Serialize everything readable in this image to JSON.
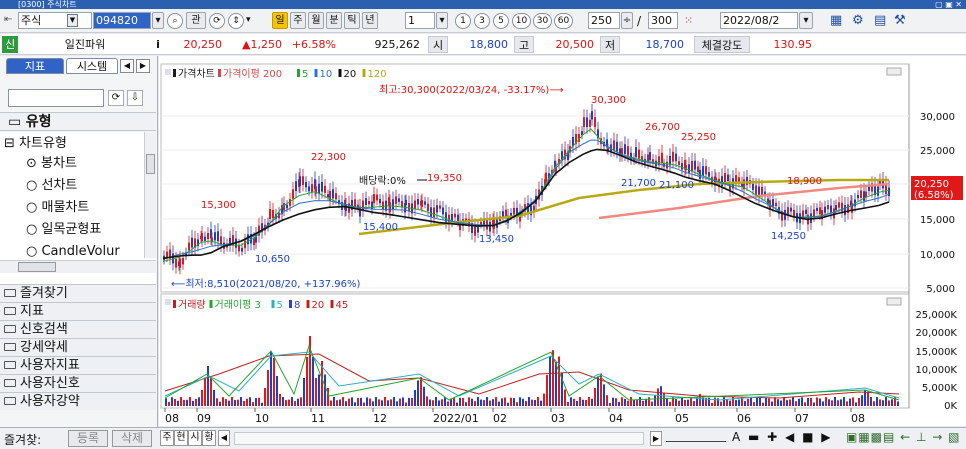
{
  "window": {
    "title": "[0300] 주식차트"
  },
  "toolbar": {
    "market": "주식",
    "code": "094820",
    "btn_gwan": "관",
    "period_buttons": [
      "일",
      "주",
      "월",
      "분",
      "틱",
      "년"
    ],
    "interval_value": "1",
    "interval_buttons": [
      "1",
      "3",
      "5",
      "10",
      "30",
      "60"
    ],
    "count_value": "250",
    "count_total": "300",
    "date_value": "2022/08/2"
  },
  "info": {
    "badge": "신",
    "name": "일진파워",
    "flag": "i",
    "price": "20,250",
    "change": "▲1,250",
    "rate": "+6.58%",
    "volume": "925,262",
    "open_label": "시",
    "open": "18,800",
    "high_label": "고",
    "high": "20,500",
    "low_label": "저",
    "low": "18,700",
    "strength_label": "체결강도",
    "strength": "130.95"
  },
  "left_panel": {
    "tabs": [
      "지표",
      "시스템"
    ],
    "section_title": "유형",
    "tree_title": "차트유형",
    "chart_types": [
      "봉차트",
      "선차트",
      "매물차트",
      "일목균형표",
      "CandleVolur"
    ],
    "categories": [
      "즐겨찾기",
      "지표",
      "신호검색",
      "강세약세",
      "사용자지표",
      "사용자신호",
      "사용자강약"
    ],
    "footer_label": "즐겨찾:",
    "footer_add": "등록",
    "footer_del": "삭제"
  },
  "chart": {
    "price_legend": [
      {
        "text": "가격차트",
        "color": "#1a1a1a"
      },
      {
        "text": "가격이평 200",
        "color": "#d34a4a"
      },
      {
        "text": "5",
        "color": "#23a52f"
      },
      {
        "text": "10",
        "color": "#2e6fcf"
      },
      {
        "text": "20",
        "color": "#111111"
      },
      {
        "text": "120",
        "color": "#b7a915"
      }
    ],
    "volume_legend": [
      {
        "text": "거래량",
        "color": "#c22020"
      },
      {
        "text": "거래이평 3",
        "color": "#23a52f"
      },
      {
        "text": "5",
        "color": "#2ab0c8"
      },
      {
        "text": "8",
        "color": "#2e3fcf"
      },
      {
        "text": "20",
        "color": "#c22020"
      },
      {
        "text": "45",
        "color": "#c22020"
      }
    ],
    "price_axis": [
      "30,000",
      "25,000",
      "20,000",
      "15,000",
      "10,000",
      "5,000"
    ],
    "volume_axis": [
      "25,000K",
      "20,000K",
      "15,000K",
      "10,000K",
      "5,000K",
      "0K"
    ],
    "last_price": "20,250",
    "last_rate": "(6.58%)",
    "annotations": {
      "max": "최고:30,300(2022/03/24, -33.17%)⟶",
      "min": "⟵최저:8,510(2021/08/20, +137.96%)",
      "dividend": "배당락:0%",
      "labels": [
        {
          "text": "15,300",
          "color": "#d11"
        },
        {
          "text": "10,650",
          "color": "#1a3fcc"
        },
        {
          "text": "22,300",
          "color": "#d11"
        },
        {
          "text": "19,350",
          "color": "#d11"
        },
        {
          "text": "15,400",
          "color": "#1a3fcc"
        },
        {
          "text": "13,450",
          "color": "#1a3fcc"
        },
        {
          "text": "30,300",
          "color": "#d11"
        },
        {
          "text": "26,700",
          "color": "#d11"
        },
        {
          "text": "25,250",
          "color": "#d11"
        },
        {
          "text": "21,700",
          "color": "#1a3fcc"
        },
        {
          "text": "21,100",
          "color": "#1a3fcc"
        },
        {
          "text": "18,900",
          "color": "#d11"
        },
        {
          "text": "14,250",
          "color": "#1a3fcc"
        }
      ]
    },
    "x_axis": [
      "08",
      "09",
      "10",
      "11",
      "12",
      "2022/01",
      "02",
      "03",
      "04",
      "05",
      "06",
      "07",
      "08"
    ]
  },
  "bottom": {
    "tabs": [
      "주",
      "현",
      "시",
      "황"
    ]
  }
}
